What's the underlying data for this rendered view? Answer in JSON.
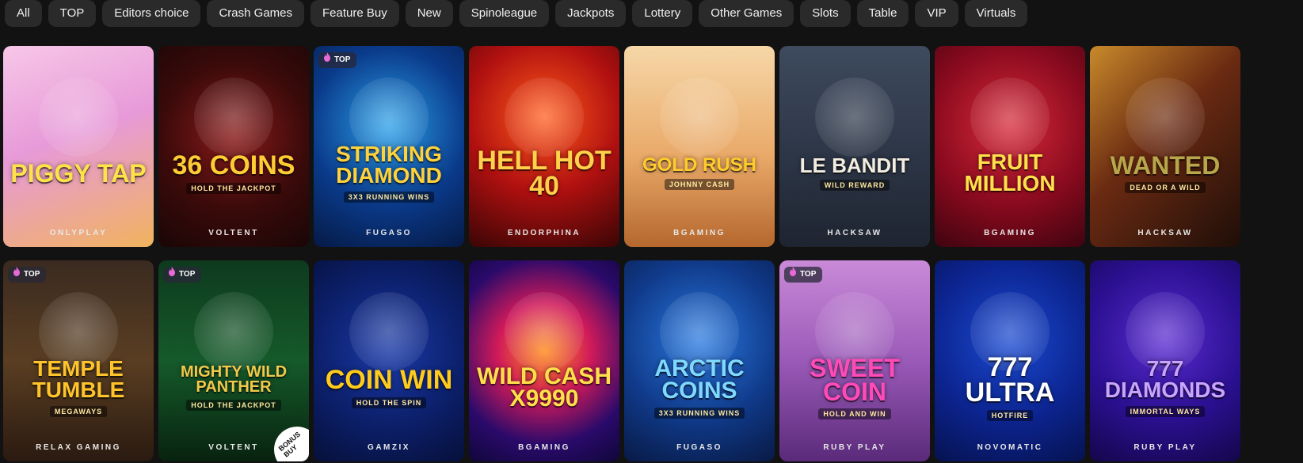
{
  "filters": [
    "All",
    "TOP",
    "Editors choice",
    "Crash Games",
    "Feature Buy",
    "New",
    "Spinoleague",
    "Jackpots",
    "Lottery",
    "Other Games",
    "Slots",
    "Table",
    "VIP",
    "Virtuals"
  ],
  "badge_text": "TOP",
  "bonus_text": "BONUS BUY",
  "games": [
    {
      "title": "Piggy Tap",
      "art_title": "PIGGY TAP",
      "art_sub": "",
      "provider": "ONLYPLAY",
      "top": false,
      "bonus": false,
      "bg": "linear-gradient(160deg,#f7c7e8 0%,#e79ad8 45%,#f1b35e 100%)",
      "title_color": "#ffe24a",
      "size": 32
    },
    {
      "title": "36 Coins",
      "art_title": "36 COINS",
      "art_sub": "HOLD THE JACKPOT",
      "provider": "VOLTENT",
      "top": false,
      "bonus": false,
      "bg": "radial-gradient(circle at 50% 45%,#8a1a1a 0%,#3a0a0a 55%,#1a0606 100%)",
      "title_color": "#ffcc33",
      "size": 34
    },
    {
      "title": "Striking Diamond",
      "art_title": "STRIKING DIAMOND",
      "art_sub": "3X3 RUNNING WINS",
      "provider": "FUGASO",
      "top": true,
      "bonus": false,
      "bg": "radial-gradient(circle at 50% 40%,#2aa0e8 0%,#0a3a8a 55%,#061a45 100%)",
      "title_color": "#ffd23c",
      "size": 28
    },
    {
      "title": "Hell Hot 40",
      "art_title": "HELL HOT 40",
      "art_sub": "",
      "provider": "ENDORPHINA",
      "top": false,
      "bonus": false,
      "bg": "radial-gradient(circle at 50% 35%,#ff5a1a 0%,#b01010 50%,#3a0505 100%)",
      "title_color": "#ffd04a",
      "size": 34
    },
    {
      "title": "Gold Rush Johnny Cash",
      "art_title": "GOLD RUSH",
      "art_sub": "JOHNNY CASH",
      "provider": "BGAMING",
      "top": false,
      "bonus": false,
      "bg": "linear-gradient(180deg,#f6d7a8 0%,#e9a968 55%,#b5672e 100%)",
      "title_color": "#ffcc2a",
      "size": 24
    },
    {
      "title": "Le Bandit",
      "art_title": "LE BANDIT",
      "art_sub": "WILD REWARD",
      "provider": "HACKSAW",
      "top": false,
      "bonus": false,
      "bg": "linear-gradient(180deg,#3e4a5e 0%,#2b3444 60%,#1e2430 100%)",
      "title_color": "#f2ede0",
      "size": 26
    },
    {
      "title": "Fruit Million",
      "art_title": "FRUIT MILLION",
      "art_sub": "",
      "provider": "BGAMING",
      "top": false,
      "bonus": false,
      "bg": "radial-gradient(circle at 50% 40%,#d62a3a 0%,#8a0a1e 55%,#3e0410 100%)",
      "title_color": "#ffe04a",
      "size": 28
    },
    {
      "title": "Wanted Dead or a Wild",
      "art_title": "WANTED",
      "art_sub": "DEAD OR A WILD",
      "provider": "HACKSAW",
      "top": false,
      "bonus": false,
      "bg": "linear-gradient(135deg,#c88a2a 0%,#6a2a12 45%,#1e0e08 100%)",
      "title_color": "#b8a64a",
      "size": 32
    },
    {
      "title": "Temple Tumble Megaways",
      "art_title": "TEMPLE TUMBLE",
      "art_sub": "MEGAWAYS",
      "provider": "RELAX GAMING",
      "top": true,
      "bonus": false,
      "bg": "linear-gradient(180deg,#3a2a20 0%,#5a3e22 50%,#2a1a10 100%)",
      "title_color": "#ffc42a",
      "size": 28
    },
    {
      "title": "Mighty Wild Panther",
      "art_title": "MIGHTY WILD PANTHER",
      "art_sub": "HOLD THE JACKPOT",
      "provider": "VOLTENT",
      "top": true,
      "bonus": true,
      "bg": "linear-gradient(180deg,#0e3a1e 0%,#155a2a 50%,#08220f 100%)",
      "title_color": "#f2c94a",
      "size": 20
    },
    {
      "title": "Coin Win",
      "art_title": "COIN WIN",
      "art_sub": "HOLD THE SPIN",
      "provider": "GAMZIX",
      "top": false,
      "bonus": false,
      "bg": "radial-gradient(circle at 50% 45%,#1a3aa8 0%,#0c1f6a 55%,#06103a 100%)",
      "title_color": "#ffcc1a",
      "size": 34
    },
    {
      "title": "Wild Cash X9990",
      "art_title": "WILD CASH X9990",
      "art_sub": "",
      "provider": "BGAMING",
      "top": false,
      "bonus": false,
      "bg": "radial-gradient(circle at 50% 45%,#ff8a1a 0%,#d01a5a 35%,#2a0a6a 70%,#10063a 100%)",
      "title_color": "#ffe04a",
      "size": 30
    },
    {
      "title": "Arctic Coins",
      "art_title": "ARCTIC COINS",
      "art_sub": "3X3 RUNNING WINS",
      "provider": "FUGASO",
      "top": false,
      "bonus": false,
      "bg": "radial-gradient(circle at 50% 40%,#2a7ae0 0%,#103a8a 55%,#081a45 100%)",
      "title_color": "#7fd8ff",
      "size": 30
    },
    {
      "title": "Sweet Coin",
      "art_title": "SWEET COIN",
      "art_sub": "HOLD AND WIN",
      "provider": "RUBY PLAY",
      "top": true,
      "bonus": false,
      "bg": "linear-gradient(180deg,#c98ad8 0%,#9a5ab8 50%,#5a2a7a 100%)",
      "title_color": "#ff4ab8",
      "size": 32
    },
    {
      "title": "Ultra Hotfire",
      "art_title": "777 ULTRA",
      "art_sub": "HOTFIRE",
      "provider": "NOVOMATIC",
      "top": false,
      "bonus": false,
      "bg": "radial-gradient(circle at 50% 40%,#1a4ad0 0%,#0c2490 55%,#061250 100%)",
      "title_color": "#ffffff",
      "size": 34
    },
    {
      "title": "Immortal Ways Diamonds",
      "art_title": "777 DIAMONDS",
      "art_sub": "IMMORTAL WAYS",
      "provider": "RUBY PLAY",
      "top": false,
      "bonus": false,
      "bg": "radial-gradient(circle at 50% 40%,#5a2ad0 0%,#2a1090 55%,#14064a 100%)",
      "title_color": "#c9a4ff",
      "size": 28
    }
  ]
}
